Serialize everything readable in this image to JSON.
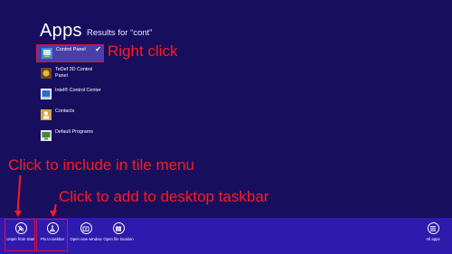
{
  "header": {
    "title": "Apps",
    "results_for": "Results for “cont”"
  },
  "apps": [
    {
      "label": "Control Panel",
      "icon": "control-panel-icon",
      "selected": true
    },
    {
      "label": "TeDef 3D Control Panel",
      "icon": "tedef-3d-icon",
      "selected": false
    },
    {
      "label": "Intel® Control Center",
      "icon": "intel-control-center-icon",
      "selected": false
    },
    {
      "label": "Contacts",
      "icon": "contacts-icon",
      "selected": false
    },
    {
      "label": "Default Programs",
      "icon": "default-programs-icon",
      "selected": false
    }
  ],
  "annotations": {
    "right_click": "Right click",
    "include_tile": "Click to include in tile menu",
    "add_taskbar": "Click to add to desktop taskbar"
  },
  "appbar": {
    "buttons": [
      {
        "label": "Unpin from Start",
        "icon": "unpin-icon"
      },
      {
        "label": "Pin to taskbar",
        "icon": "pin-taskbar-icon"
      },
      {
        "label": "Open new window",
        "icon": "new-window-icon"
      },
      {
        "label": "Open file location",
        "icon": "file-location-icon"
      },
      {
        "label": "All apps",
        "icon": "all-apps-icon"
      }
    ]
  },
  "colors": {
    "background": "#180e5e",
    "appbar": "#2e1aad",
    "annotation": "#ff1b1b",
    "highlight_border": "#d2124a"
  }
}
